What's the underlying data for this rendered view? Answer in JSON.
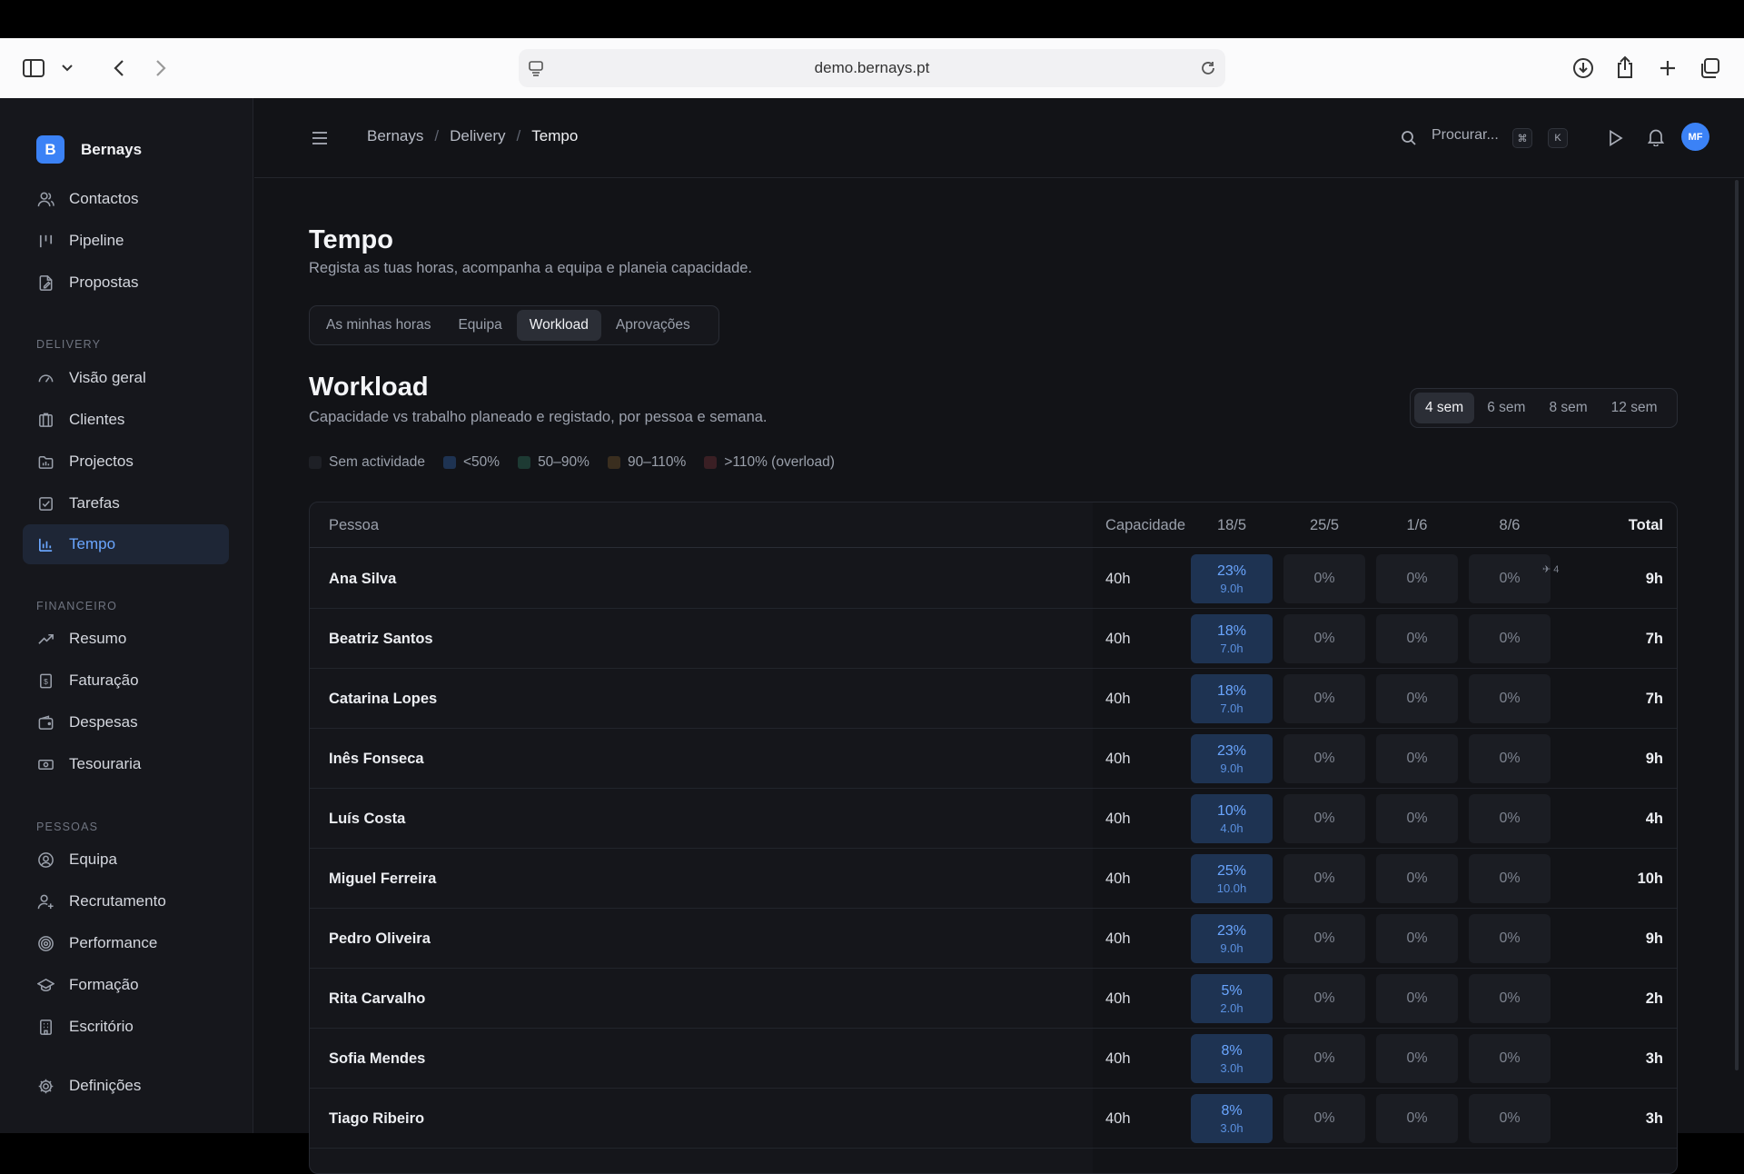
{
  "browser": {
    "url": "demo.bernays.pt"
  },
  "brand": {
    "logo_letter": "B",
    "name": "Bernays"
  },
  "nav": {
    "top": [
      {
        "label": "Contactos",
        "icon": "users-icon"
      },
      {
        "label": "Pipeline",
        "icon": "pipeline-icon"
      },
      {
        "label": "Propostas",
        "icon": "document-icon"
      }
    ],
    "delivery_title": "DELIVERY",
    "delivery": [
      {
        "label": "Visão geral",
        "icon": "gauge-icon"
      },
      {
        "label": "Clientes",
        "icon": "building-icon"
      },
      {
        "label": "Projectos",
        "icon": "folder-icon"
      },
      {
        "label": "Tarefas",
        "icon": "checkbox-icon"
      },
      {
        "label": "Tempo",
        "icon": "bar-chart-icon",
        "active": true
      }
    ],
    "finance_title": "FINANCEIRO",
    "finance": [
      {
        "label": "Resumo",
        "icon": "trend-icon"
      },
      {
        "label": "Faturação",
        "icon": "invoice-icon"
      },
      {
        "label": "Despesas",
        "icon": "wallet-icon"
      },
      {
        "label": "Tesouraria",
        "icon": "banknote-icon"
      }
    ],
    "people_title": "PESSOAS",
    "people": [
      {
        "label": "Equipa",
        "icon": "user-circle-icon"
      },
      {
        "label": "Recrutamento",
        "icon": "user-plus-icon"
      },
      {
        "label": "Performance",
        "icon": "target-icon"
      },
      {
        "label": "Formação",
        "icon": "graduation-icon"
      },
      {
        "label": "Escritório",
        "icon": "office-icon"
      }
    ],
    "settings": {
      "label": "Definições",
      "icon": "gear-icon"
    }
  },
  "header": {
    "breadcrumb": [
      "Bernays",
      "Delivery",
      "Tempo"
    ],
    "search_placeholder": "Procurar...",
    "kbd1": "⌘",
    "kbd2": "K",
    "avatar": "MF"
  },
  "page": {
    "title": "Tempo",
    "subtitle": "Regista as tuas horas, acompanha a equipa e planeia capacidade.",
    "tabs": [
      "As minhas horas",
      "Equipa",
      "Workload",
      "Aprovações"
    ],
    "active_tab": "Workload"
  },
  "workload": {
    "title": "Workload",
    "subtitle": "Capacidade vs trabalho planeado e registado, por pessoa e semana.",
    "ranges": [
      "4 sem",
      "6 sem",
      "8 sem",
      "12 sem"
    ],
    "active_range": "4 sem",
    "legend": [
      {
        "label": "Sem actividade",
        "color": "#1e2026"
      },
      {
        "label": "<50%",
        "color": "#1e3352"
      },
      {
        "label": "50–90%",
        "color": "#1d3a33"
      },
      {
        "label": "90–110%",
        "color": "#3a2e1f"
      },
      {
        "label": ">110% (overload)",
        "color": "#3a1f24"
      }
    ],
    "columns": {
      "person": "Pessoa",
      "capacity": "Capacidade",
      "weeks": [
        "18/5",
        "25/5",
        "1/6",
        "8/6"
      ],
      "total": "Total"
    },
    "leave_marker": "✈ 4",
    "rows": [
      {
        "name": "Ana Silva",
        "capacity": "40h",
        "weeks": [
          {
            "pct": "23%",
            "hours": "9.0h"
          },
          {
            "pct": "0%"
          },
          {
            "pct": "0%"
          },
          {
            "pct": "0%"
          }
        ],
        "total": "9h"
      },
      {
        "name": "Beatriz Santos",
        "capacity": "40h",
        "weeks": [
          {
            "pct": "18%",
            "hours": "7.0h"
          },
          {
            "pct": "0%"
          },
          {
            "pct": "0%"
          },
          {
            "pct": "0%"
          }
        ],
        "total": "7h"
      },
      {
        "name": "Catarina Lopes",
        "capacity": "40h",
        "weeks": [
          {
            "pct": "18%",
            "hours": "7.0h"
          },
          {
            "pct": "0%"
          },
          {
            "pct": "0%"
          },
          {
            "pct": "0%"
          }
        ],
        "total": "7h"
      },
      {
        "name": "Inês Fonseca",
        "capacity": "40h",
        "weeks": [
          {
            "pct": "23%",
            "hours": "9.0h"
          },
          {
            "pct": "0%"
          },
          {
            "pct": "0%"
          },
          {
            "pct": "0%"
          }
        ],
        "total": "9h"
      },
      {
        "name": "Luís Costa",
        "capacity": "40h",
        "weeks": [
          {
            "pct": "10%",
            "hours": "4.0h"
          },
          {
            "pct": "0%"
          },
          {
            "pct": "0%"
          },
          {
            "pct": "0%"
          }
        ],
        "total": "4h"
      },
      {
        "name": "Miguel Ferreira",
        "capacity": "40h",
        "weeks": [
          {
            "pct": "25%",
            "hours": "10.0h"
          },
          {
            "pct": "0%"
          },
          {
            "pct": "0%"
          },
          {
            "pct": "0%"
          }
        ],
        "total": "10h"
      },
      {
        "name": "Pedro Oliveira",
        "capacity": "40h",
        "weeks": [
          {
            "pct": "23%",
            "hours": "9.0h"
          },
          {
            "pct": "0%"
          },
          {
            "pct": "0%"
          },
          {
            "pct": "0%"
          }
        ],
        "total": "9h"
      },
      {
        "name": "Rita Carvalho",
        "capacity": "40h",
        "weeks": [
          {
            "pct": "5%",
            "hours": "2.0h"
          },
          {
            "pct": "0%"
          },
          {
            "pct": "0%"
          },
          {
            "pct": "0%"
          }
        ],
        "total": "2h"
      },
      {
        "name": "Sofia Mendes",
        "capacity": "40h",
        "weeks": [
          {
            "pct": "8%",
            "hours": "3.0h"
          },
          {
            "pct": "0%"
          },
          {
            "pct": "0%"
          },
          {
            "pct": "0%"
          }
        ],
        "total": "3h"
      },
      {
        "name": "Tiago Ribeiro",
        "capacity": "40h",
        "weeks": [
          {
            "pct": "8%",
            "hours": "3.0h"
          },
          {
            "pct": "0%"
          },
          {
            "pct": "0%"
          },
          {
            "pct": "0%"
          }
        ],
        "total": "3h"
      }
    ]
  }
}
